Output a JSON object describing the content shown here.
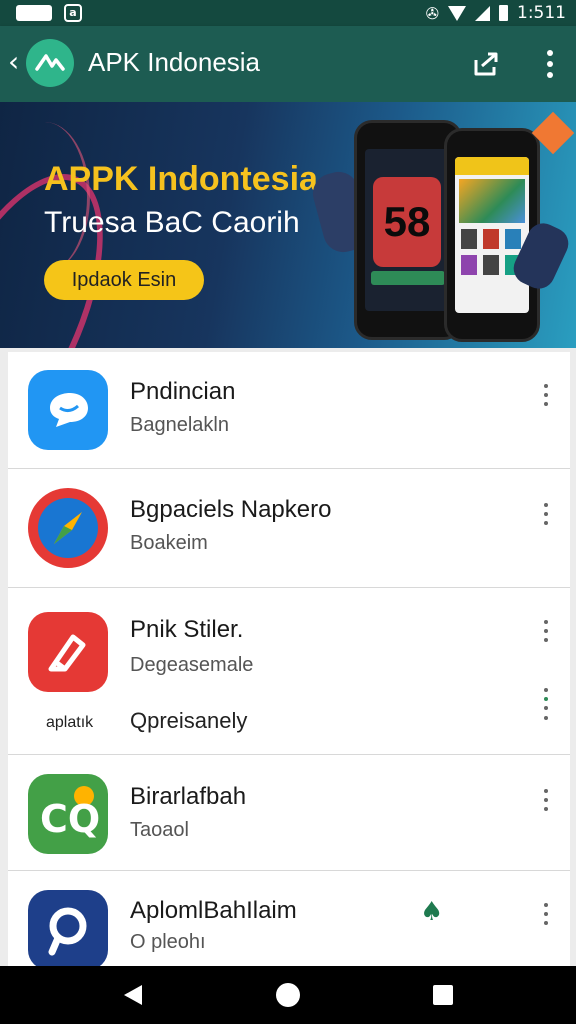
{
  "status_bar": {
    "time": "1:511",
    "icons": [
      "battery-pill-icon",
      "app-notification-icon",
      "vibrate-icon",
      "wifi-icon",
      "signal-icon",
      "battery-icon"
    ],
    "notification_glyph": "a"
  },
  "app_bar": {
    "title": "APK Indonesia",
    "icons": [
      "back-arrow-icon",
      "app-logo-icon",
      "share-icon",
      "overflow-menu-icon"
    ]
  },
  "banner": {
    "title": "APPK Indontesia",
    "subtitle": "Truesa BaC Caorih",
    "button_label": "Ipdaok Esin",
    "phone_big_text": "58",
    "colors": {
      "title": "#f6c21e",
      "button": "#f5c518"
    }
  },
  "apps": [
    {
      "name": "Pndincian",
      "subtitle": "Bagnelakln",
      "icon": "chat-bubble-icon",
      "icon_color": "#2196f3"
    },
    {
      "name": "Bgpaciels Napkero",
      "subtitle": "Boakeim",
      "icon": "compass-icon",
      "icon_color": "#e53935"
    },
    {
      "name": "Pnik Stiler.",
      "subtitle": "Degeasemale",
      "extra": "Qpreisanely",
      "caption": "aplatık",
      "icon": "stylus-icon",
      "icon_color": "#e53935"
    },
    {
      "name": "Birarlafbah",
      "subtitle": "Taoaol",
      "icon": "cq-logo-icon",
      "icon_color": "#43a047"
    },
    {
      "name": "AplomlBahIlaim",
      "subtitle": "O pleohı",
      "icon": "search-bubble-icon",
      "icon_color": "#1e3f8a",
      "badge": "♠"
    }
  ],
  "nav_bar": {
    "icons": [
      "back-triangle-icon",
      "home-circle-icon",
      "recents-square-icon"
    ]
  }
}
